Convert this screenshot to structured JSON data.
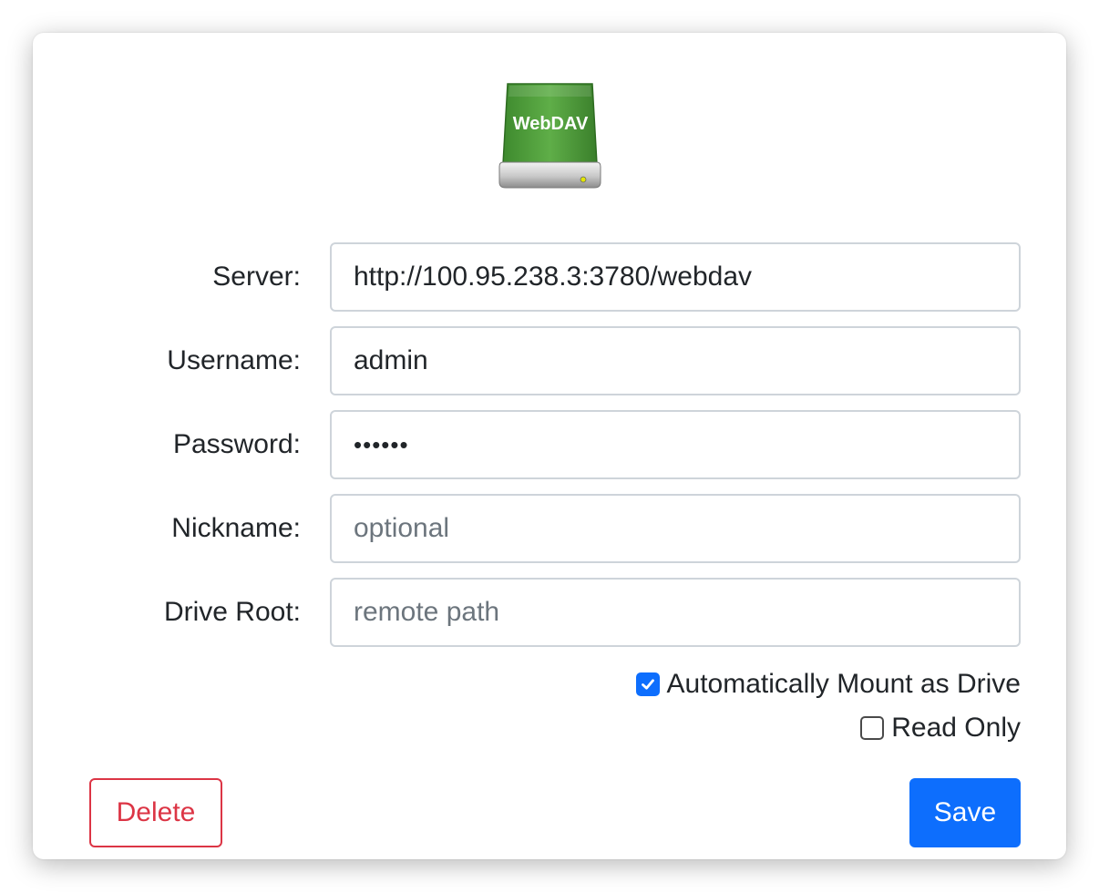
{
  "icon": {
    "name": "webdav-drive-icon",
    "label": "WebDAV",
    "color": "#4f9a3c"
  },
  "form": {
    "server": {
      "label": "Server:",
      "value": "http://100.95.238.3:3780/webdav",
      "placeholder": ""
    },
    "username": {
      "label": "Username:",
      "value": "admin",
      "placeholder": ""
    },
    "password": {
      "label": "Password:",
      "value": "••••••",
      "placeholder": ""
    },
    "nickname": {
      "label": "Nickname:",
      "value": "",
      "placeholder": "optional"
    },
    "drive_root": {
      "label": "Drive Root:",
      "value": "",
      "placeholder": "remote path"
    }
  },
  "options": {
    "auto_mount": {
      "label": "Automatically Mount as Drive",
      "checked": true
    },
    "read_only": {
      "label": "Read Only",
      "checked": false
    }
  },
  "buttons": {
    "delete_label": "Delete",
    "save_label": "Save"
  },
  "colors": {
    "primary": "#0d6efd",
    "danger": "#dc3545",
    "border": "#ced4da"
  }
}
